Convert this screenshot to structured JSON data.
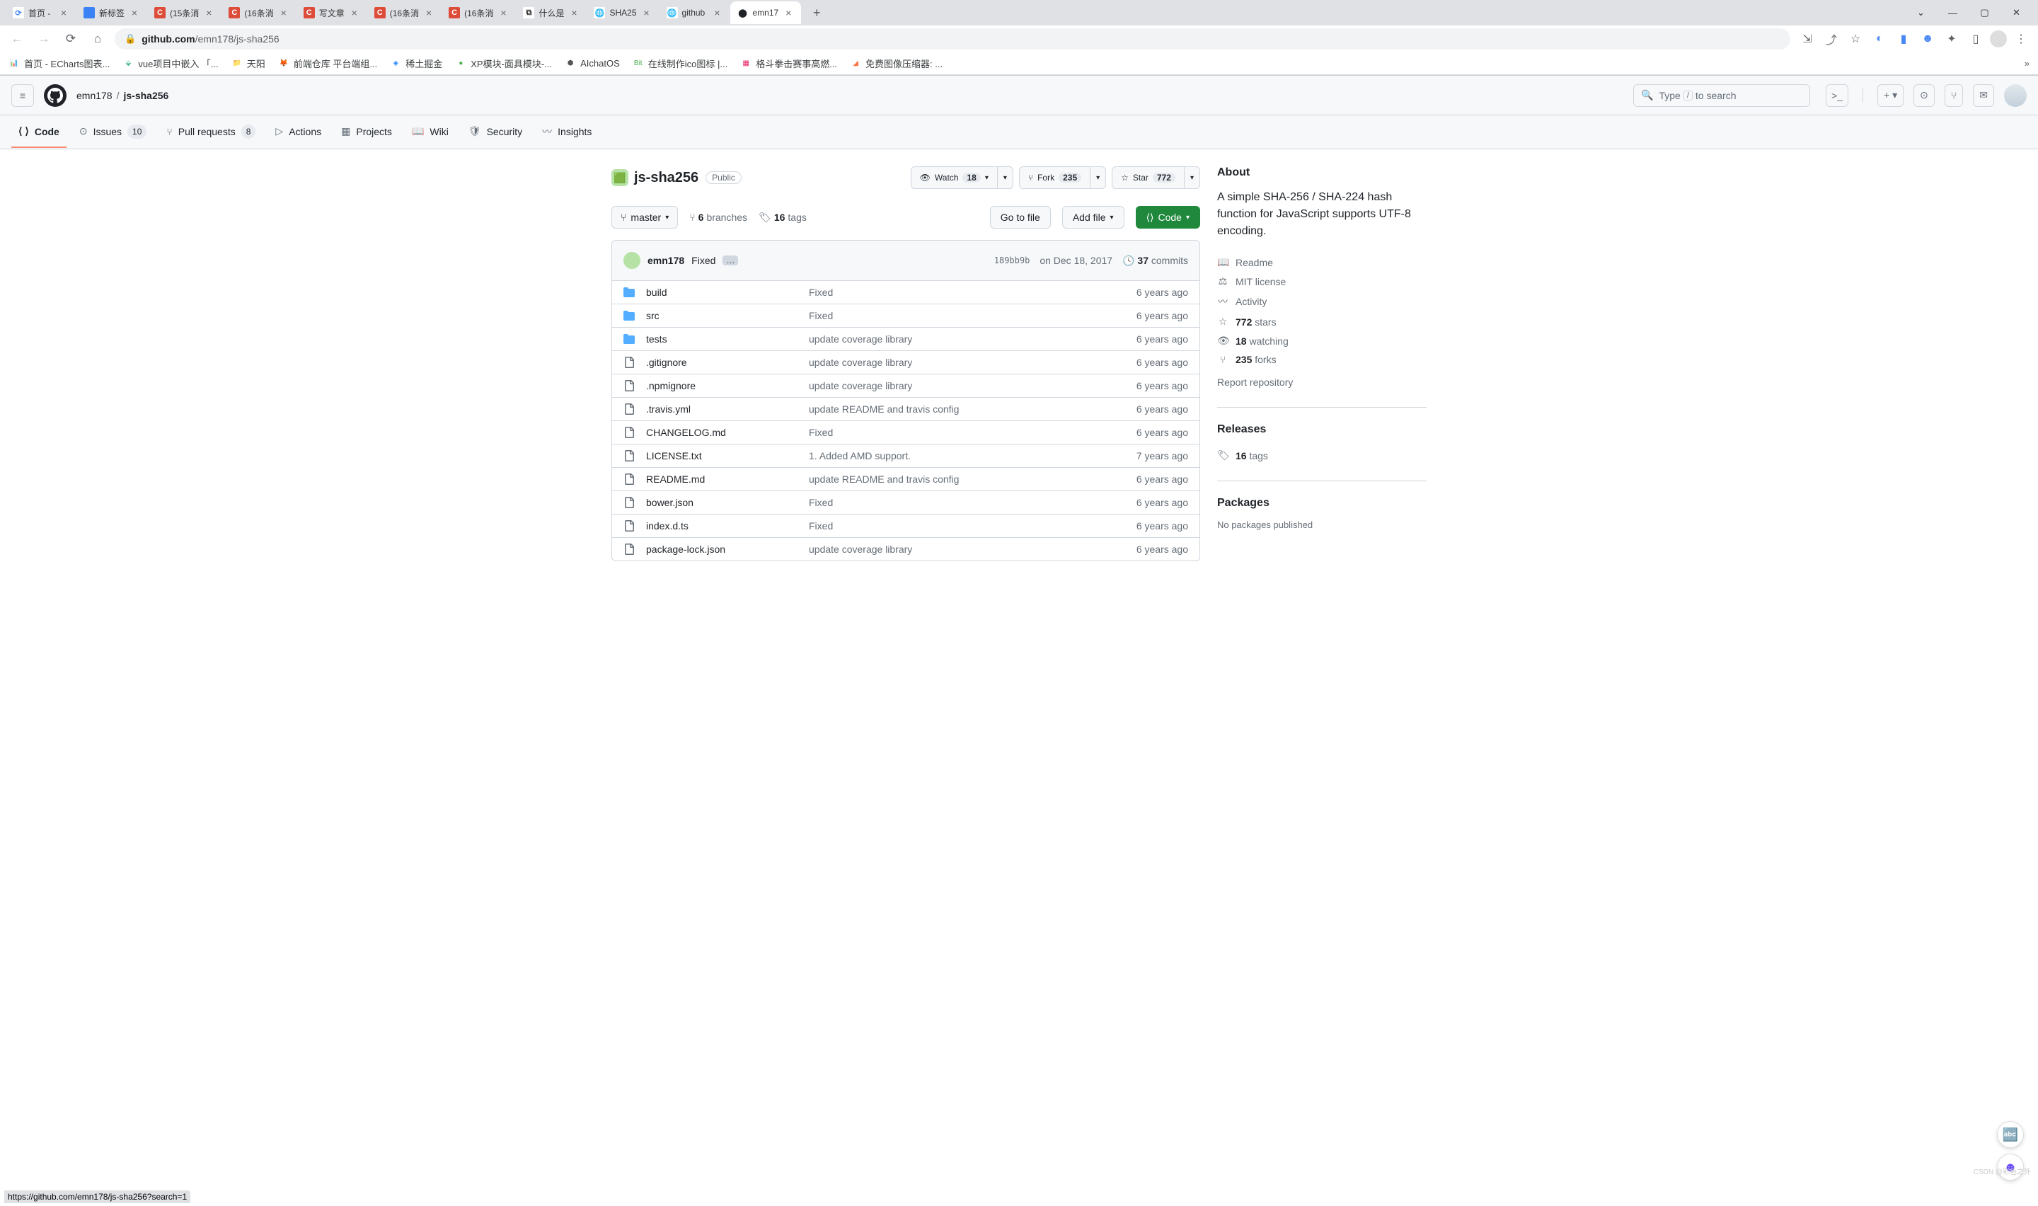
{
  "browser": {
    "tabs": [
      {
        "title": "首页 - ",
        "icon_bg": "#fff",
        "icon_text": "⟳",
        "icon_color": "#4687f4"
      },
      {
        "title": "新标签",
        "icon_bg": "#3b82f6",
        "icon_text": "",
        "icon_color": "#fff"
      },
      {
        "title": "(15条消",
        "icon_bg": "#dd4b39",
        "icon_text": "C",
        "icon_color": "#fff"
      },
      {
        "title": "(16条消",
        "icon_bg": "#dd4b39",
        "icon_text": "C",
        "icon_color": "#fff"
      },
      {
        "title": "写文章",
        "icon_bg": "#dd4b39",
        "icon_text": "C",
        "icon_color": "#fff"
      },
      {
        "title": "(16条消",
        "icon_bg": "#dd4b39",
        "icon_text": "C",
        "icon_color": "#fff"
      },
      {
        "title": "(16条消",
        "icon_bg": "#dd4b39",
        "icon_text": "C",
        "icon_color": "#fff"
      },
      {
        "title": "什么是",
        "icon_bg": "#fff",
        "icon_text": "⧉",
        "icon_color": "#333"
      },
      {
        "title": "SHA25",
        "icon_bg": "#fff",
        "icon_text": "🌐",
        "icon_color": "#666"
      },
      {
        "title": "github",
        "icon_bg": "#fff",
        "icon_text": "🌐",
        "icon_color": "#666"
      },
      {
        "title": "emn17",
        "icon_bg": "#fff",
        "icon_text": "⬤",
        "icon_color": "#1f2328",
        "active": true
      }
    ],
    "url_host": "github.com",
    "url_path": "/emn178/js-sha256",
    "bookmarks": [
      {
        "label": "首页 - ECharts图表...",
        "icon": "📊",
        "color": "#e8710a"
      },
      {
        "label": "vue项目中嵌入 「...",
        "icon": "⬙",
        "color": "#41b883"
      },
      {
        "label": "天阳",
        "icon": "📁",
        "color": "#f6c445"
      },
      {
        "label": "前端仓库 平台端组...",
        "icon": "🦊",
        "color": "#fc6d26"
      },
      {
        "label": "稀土掘金",
        "icon": "◈",
        "color": "#1e80ff"
      },
      {
        "label": "XP模块-面具模块-...",
        "icon": "●",
        "color": "#4caf50"
      },
      {
        "label": "AIchatOS",
        "icon": "⬢",
        "color": "#555"
      },
      {
        "label": "在线制作ico图标 |...",
        "icon": "Bit",
        "color": "#4caf50"
      },
      {
        "label": "格斗拳击赛事高燃...",
        "icon": "▦",
        "color": "#e91e63"
      },
      {
        "label": "免费图像压缩器: ...",
        "icon": "◢",
        "color": "#ff7043"
      }
    ],
    "status_url": "https://github.com/emn178/js-sha256?search=1"
  },
  "github": {
    "owner": "emn178",
    "repo": "js-sha256",
    "search_prefix": "Type",
    "search_suffix": "to search",
    "tabs": [
      {
        "label": "Code",
        "icon": "⟨ ⟩",
        "active": true
      },
      {
        "label": "Issues",
        "icon": "⊙",
        "count": "10"
      },
      {
        "label": "Pull requests",
        "icon": "⑂",
        "count": "8"
      },
      {
        "label": "Actions",
        "icon": "▷",
        "count": null
      },
      {
        "label": "Projects",
        "icon": "▦",
        "count": null
      },
      {
        "label": "Wiki",
        "icon": "📖",
        "count": null
      },
      {
        "label": "Security",
        "icon": "🛡",
        "count": null
      },
      {
        "label": "Insights",
        "icon": "〰",
        "count": null
      }
    ],
    "repo_label": "Public",
    "actions": {
      "watch": "Watch",
      "watch_count": "18",
      "fork": "Fork",
      "fork_count": "235",
      "star": "Star",
      "star_count": "772"
    },
    "branch": "master",
    "branches_n": "6",
    "branches_l": "branches",
    "tags_n": "16",
    "tags_l": "tags",
    "goto": "Go to file",
    "addfile": "Add file",
    "code_btn": "Code",
    "commit": {
      "author": "emn178",
      "msg": "Fixed",
      "sha": "189bb9b",
      "date": "on Dec 18, 2017",
      "count_n": "37",
      "count_l": "commits"
    },
    "files": [
      {
        "type": "dir",
        "name": "build",
        "msg": "Fixed",
        "time": "6 years ago"
      },
      {
        "type": "dir",
        "name": "src",
        "msg": "Fixed",
        "time": "6 years ago"
      },
      {
        "type": "dir",
        "name": "tests",
        "msg": "update coverage library",
        "time": "6 years ago"
      },
      {
        "type": "file",
        "name": ".gitignore",
        "msg": "update coverage library",
        "time": "6 years ago"
      },
      {
        "type": "file",
        "name": ".npmignore",
        "msg": "update coverage library",
        "time": "6 years ago"
      },
      {
        "type": "file",
        "name": ".travis.yml",
        "msg": "update README and travis config",
        "time": "6 years ago"
      },
      {
        "type": "file",
        "name": "CHANGELOG.md",
        "msg": "Fixed",
        "time": "6 years ago"
      },
      {
        "type": "file",
        "name": "LICENSE.txt",
        "msg": "1. Added AMD support.",
        "time": "7 years ago"
      },
      {
        "type": "file",
        "name": "README.md",
        "msg": "update README and travis config",
        "time": "6 years ago"
      },
      {
        "type": "file",
        "name": "bower.json",
        "msg": "Fixed",
        "time": "6 years ago"
      },
      {
        "type": "file",
        "name": "index.d.ts",
        "msg": "Fixed",
        "time": "6 years ago"
      },
      {
        "type": "file",
        "name": "package-lock.json",
        "msg": "update coverage library",
        "time": "6 years ago"
      }
    ],
    "about": {
      "title": "About",
      "desc": "A simple SHA-256 / SHA-224 hash function for JavaScript supports UTF-8 encoding.",
      "links": [
        {
          "icon": "📖",
          "text": "Readme"
        },
        {
          "icon": "⚖",
          "text": "MIT license"
        },
        {
          "icon": "〰",
          "text": "Activity"
        },
        {
          "icon": "☆",
          "b": "772",
          "text": "stars"
        },
        {
          "icon": "👁",
          "b": "18",
          "text": "watching"
        },
        {
          "icon": "⑂",
          "b": "235",
          "text": "forks"
        }
      ],
      "report": "Report repository"
    },
    "releases": {
      "title": "Releases",
      "tags_n": "16",
      "tags_l": "tags"
    },
    "packages": {
      "title": "Packages",
      "none": "No packages published"
    }
  },
  "watermark": "CSDN @彩色之外"
}
